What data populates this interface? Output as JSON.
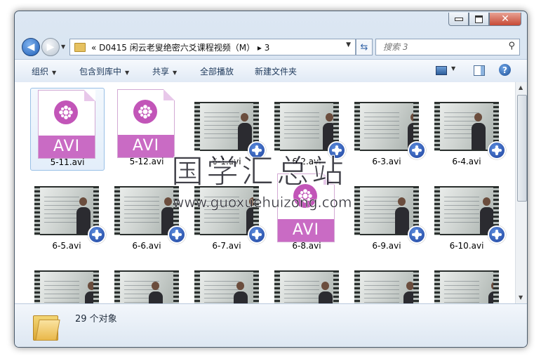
{
  "address": {
    "path": "« D0415 闲云老叟绝密六爻课程视频（M） ▸ 3"
  },
  "search": {
    "placeholder": "搜索 3"
  },
  "toolbar": {
    "organize": "组织",
    "include_library": "包含到库中",
    "share": "共享",
    "play_all": "全部播放",
    "new_folder": "新建文件夹"
  },
  "files": [
    {
      "name": "5-11.avi",
      "kind": "avi-icon",
      "selected": true
    },
    {
      "name": "5-12.avi",
      "kind": "avi-icon"
    },
    {
      "name": "6-1.avi",
      "kind": "video-thumb"
    },
    {
      "name": "6-2.avi",
      "kind": "video-thumb"
    },
    {
      "name": "6-3.avi",
      "kind": "video-thumb"
    },
    {
      "name": "6-4.avi",
      "kind": "video-thumb"
    },
    {
      "name": "6-5.avi",
      "kind": "video-thumb"
    },
    {
      "name": "6-6.avi",
      "kind": "video-thumb"
    },
    {
      "name": "6-7.avi",
      "kind": "video-thumb"
    },
    {
      "name": "6-8.avi",
      "kind": "avi-icon"
    },
    {
      "name": "6-9.avi",
      "kind": "video-thumb"
    },
    {
      "name": "6-10.avi",
      "kind": "video-thumb"
    },
    {
      "name": "",
      "kind": "video-thumb"
    },
    {
      "name": "",
      "kind": "video-thumb"
    },
    {
      "name": "",
      "kind": "video-thumb"
    },
    {
      "name": "",
      "kind": "video-thumb"
    },
    {
      "name": "",
      "kind": "video-thumb"
    },
    {
      "name": "",
      "kind": "video-thumb"
    }
  ],
  "avi_label": "AVI",
  "status": {
    "count": "29 个对象"
  },
  "watermark": {
    "cn": "国学汇总站",
    "url": "www.guoxuehuizong.com"
  },
  "colors": {
    "avi_band": "#c96bc4",
    "selection": "#e3eefa"
  }
}
